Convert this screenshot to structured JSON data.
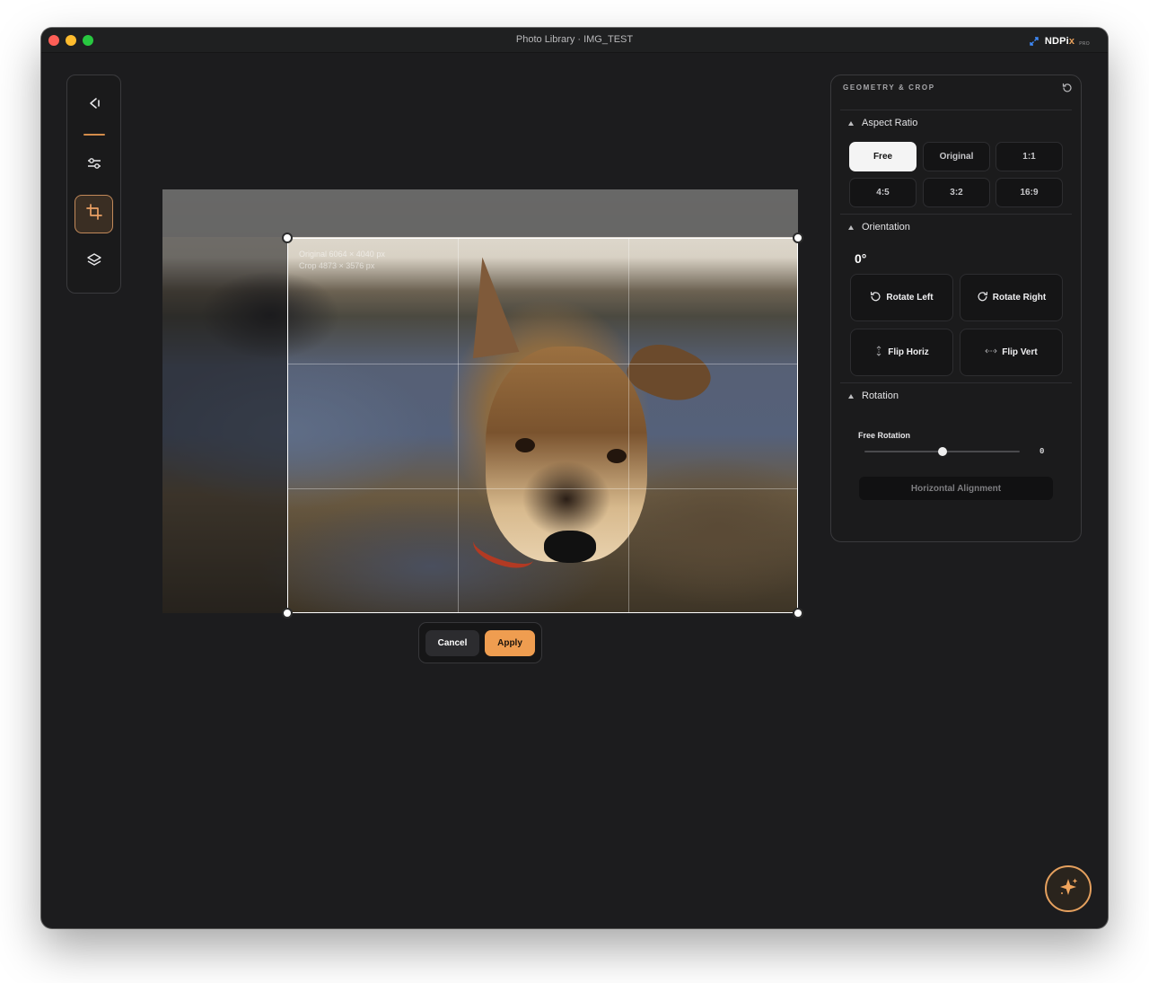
{
  "window": {
    "title": "Photo Library · IMG_TEST"
  },
  "brand": {
    "name_prefix": "NDPi",
    "name_suffix": "x",
    "badge": "PRO"
  },
  "toolbar": {
    "items": [
      {
        "name": "back-arrow",
        "icon": "arrow-left-icon"
      },
      {
        "name": "adjustments",
        "icon": "sliders-icon"
      },
      {
        "name": "crop",
        "icon": "crop-icon",
        "active": true
      },
      {
        "name": "layers",
        "icon": "layers-icon"
      }
    ]
  },
  "crop": {
    "original_label": "Original 6064 × 4040 px",
    "crop_label": "Crop 4873 × 3576 px"
  },
  "actions": {
    "cancel": "Cancel",
    "apply": "Apply"
  },
  "panel": {
    "title": "GEOMETRY & CROP",
    "aspect_ratio": {
      "heading": "Aspect Ratio",
      "options": [
        "Free",
        "Original",
        "1:1",
        "4:5",
        "3:2",
        "16:9"
      ],
      "selected": "Free"
    },
    "orientation": {
      "heading": "Orientation",
      "degrees": "0°",
      "rotate_left": "Rotate Left",
      "rotate_right": "Rotate Right",
      "flip_horiz": "Flip Horiz",
      "flip_vert": "Flip Vert"
    },
    "rotation": {
      "heading": "Rotation",
      "slider_label": "Free Rotation",
      "value": "0",
      "position_fraction": 0.5,
      "horizontal_alignment": "Horizontal Alignment"
    }
  },
  "fab": {
    "icon": "sparkle-icon"
  },
  "colors": {
    "accent": "#ef9d50",
    "background": "#1c1c1e",
    "panel": "#1b1b1c"
  }
}
